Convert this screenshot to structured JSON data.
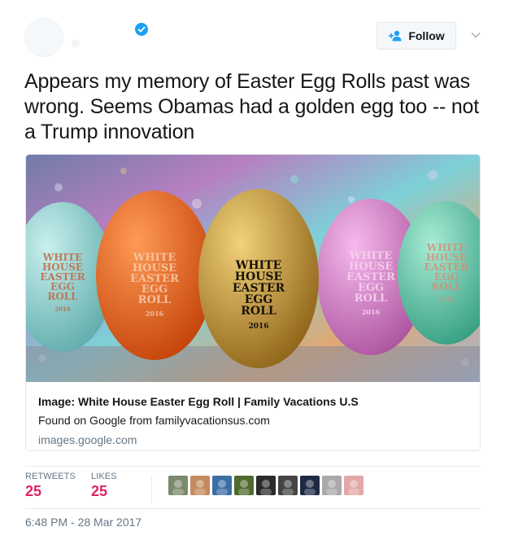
{
  "tweet": {
    "text": "Appears my memory of Easter Egg Rolls past was wrong. Seems Obamas had a golden egg too -- not a Trump innovation",
    "timestamp": "6:48 PM - 28 Mar 2017"
  },
  "header": {
    "follow_label": "Follow",
    "verified_color": "#1da1f2"
  },
  "card": {
    "title": "Image: White House Easter Egg Roll | Family Vacations U.S",
    "description": "Found on Google from familyvacationsus.com",
    "domain": "images.google.com",
    "eggs": [
      {
        "color": "#8fd3d1",
        "text_lines": [
          "WHITE",
          "HOUSE",
          "EASTER",
          "EGG",
          "ROLL"
        ],
        "year": "2016"
      },
      {
        "color": "#f25a12",
        "text_lines": [
          "WHITE",
          "HOUSE",
          "EASTER",
          "EGG",
          "ROLL"
        ],
        "year": "2016"
      },
      {
        "color": "#c9962e",
        "text_lines": [
          "WHITE",
          "HOUSE",
          "EASTER",
          "EGG",
          "ROLL"
        ],
        "year": "2016"
      },
      {
        "color": "#d67cc7",
        "text_lines": [
          "WHITE",
          "HOUSE",
          "EASTER",
          "EGG",
          "ROLL"
        ],
        "year": "2016"
      },
      {
        "color": "#5fc7a8",
        "text_lines": [
          "WHITE",
          "HOUSE",
          "EASTER",
          "EGG",
          "ROLL"
        ],
        "year": "2016"
      }
    ]
  },
  "stats": {
    "retweets_label": "RETWEETS",
    "retweets_count": "25",
    "likes_label": "LIKES",
    "likes_count": "25",
    "stat_color": "#e0245e"
  },
  "likers": [
    {
      "name": "liker-avatar-1",
      "color": "#7a8a6b"
    },
    {
      "name": "liker-avatar-2",
      "color": "#c48a5e"
    },
    {
      "name": "liker-avatar-3",
      "color": "#3a6ea5"
    },
    {
      "name": "liker-avatar-4",
      "color": "#4f6a2e"
    },
    {
      "name": "liker-avatar-5",
      "color": "#2b2b2b"
    },
    {
      "name": "liker-avatar-6",
      "color": "#444444"
    },
    {
      "name": "liker-avatar-7",
      "color": "#1e2a44"
    },
    {
      "name": "liker-avatar-8",
      "color": "#a9a9a9"
    },
    {
      "name": "liker-avatar-9",
      "color": "#e2a7a7"
    }
  ]
}
